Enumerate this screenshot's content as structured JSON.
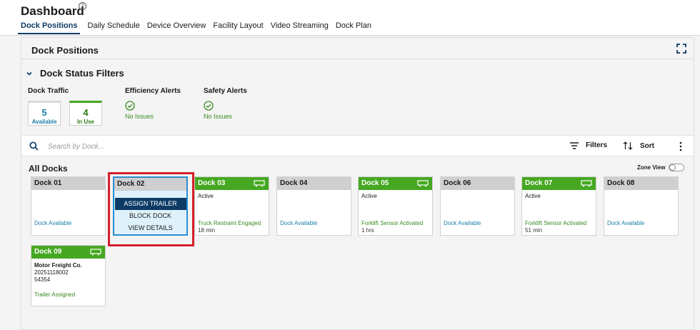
{
  "app": {
    "title": "Dashboard"
  },
  "tabs": [
    {
      "label": "Dock Positions",
      "active": true
    },
    {
      "label": "Daily Schedule",
      "active": false
    },
    {
      "label": "Device Overview",
      "active": false
    },
    {
      "label": "Facility Layout",
      "active": false
    },
    {
      "label": "Video Streaming",
      "active": false
    },
    {
      "label": "Dock Plan",
      "active": false
    }
  ],
  "panel": {
    "title": "Dock Positions"
  },
  "filters": {
    "title": "Dock Status Filters",
    "dock_traffic": {
      "label": "Dock Traffic",
      "available": {
        "count": "5",
        "label": "Available"
      },
      "in_use": {
        "count": "4",
        "label": "In Use"
      }
    },
    "efficiency": {
      "label": "Efficiency Alerts",
      "status": "No Issues"
    },
    "safety": {
      "label": "Safety Alerts",
      "status": "No Issues"
    }
  },
  "toolbar": {
    "search_placeholder": "Search by Dock...",
    "filters_label": "Filters",
    "sort_label": "Sort"
  },
  "docks_section": {
    "title": "All Docks",
    "zone_view_label": "Zone View",
    "zone_view_on": false
  },
  "docks": [
    {
      "name": "Dock 01",
      "state": "available",
      "status": "Dock Available"
    },
    {
      "name": "Dock 02",
      "state": "selected",
      "menu": [
        "ASSIGN TRAILER",
        "BLOCK DOCK",
        "VIEW DETAILS"
      ]
    },
    {
      "name": "Dock 03",
      "state": "active",
      "line1": "Active",
      "status": "Truck Restraint Engaged",
      "time": "18 min"
    },
    {
      "name": "Dock 04",
      "state": "available",
      "status": "Dock Available"
    },
    {
      "name": "Dock 05",
      "state": "active",
      "line1": "Active",
      "status": "Forklift Sensor Activated",
      "time": "1 hrs"
    },
    {
      "name": "Dock 06",
      "state": "available",
      "status": "Dock Available"
    },
    {
      "name": "Dock 07",
      "state": "active",
      "line1": "Active",
      "status": "Forklift Sensor Activated",
      "time": "51 min"
    },
    {
      "name": "Dock 08",
      "state": "available",
      "status": "Dock Available"
    },
    {
      "name": "Dock 09",
      "state": "active",
      "carrier": "Motor Freight Co.",
      "line2": "20251118002",
      "line3": "54354",
      "status": "Trailer Assigned"
    }
  ],
  "colors": {
    "brand_navy": "#0d3b66",
    "active_green": "#46a822",
    "available_blue": "#1a7fa8",
    "highlight_red": "#d4202a"
  }
}
